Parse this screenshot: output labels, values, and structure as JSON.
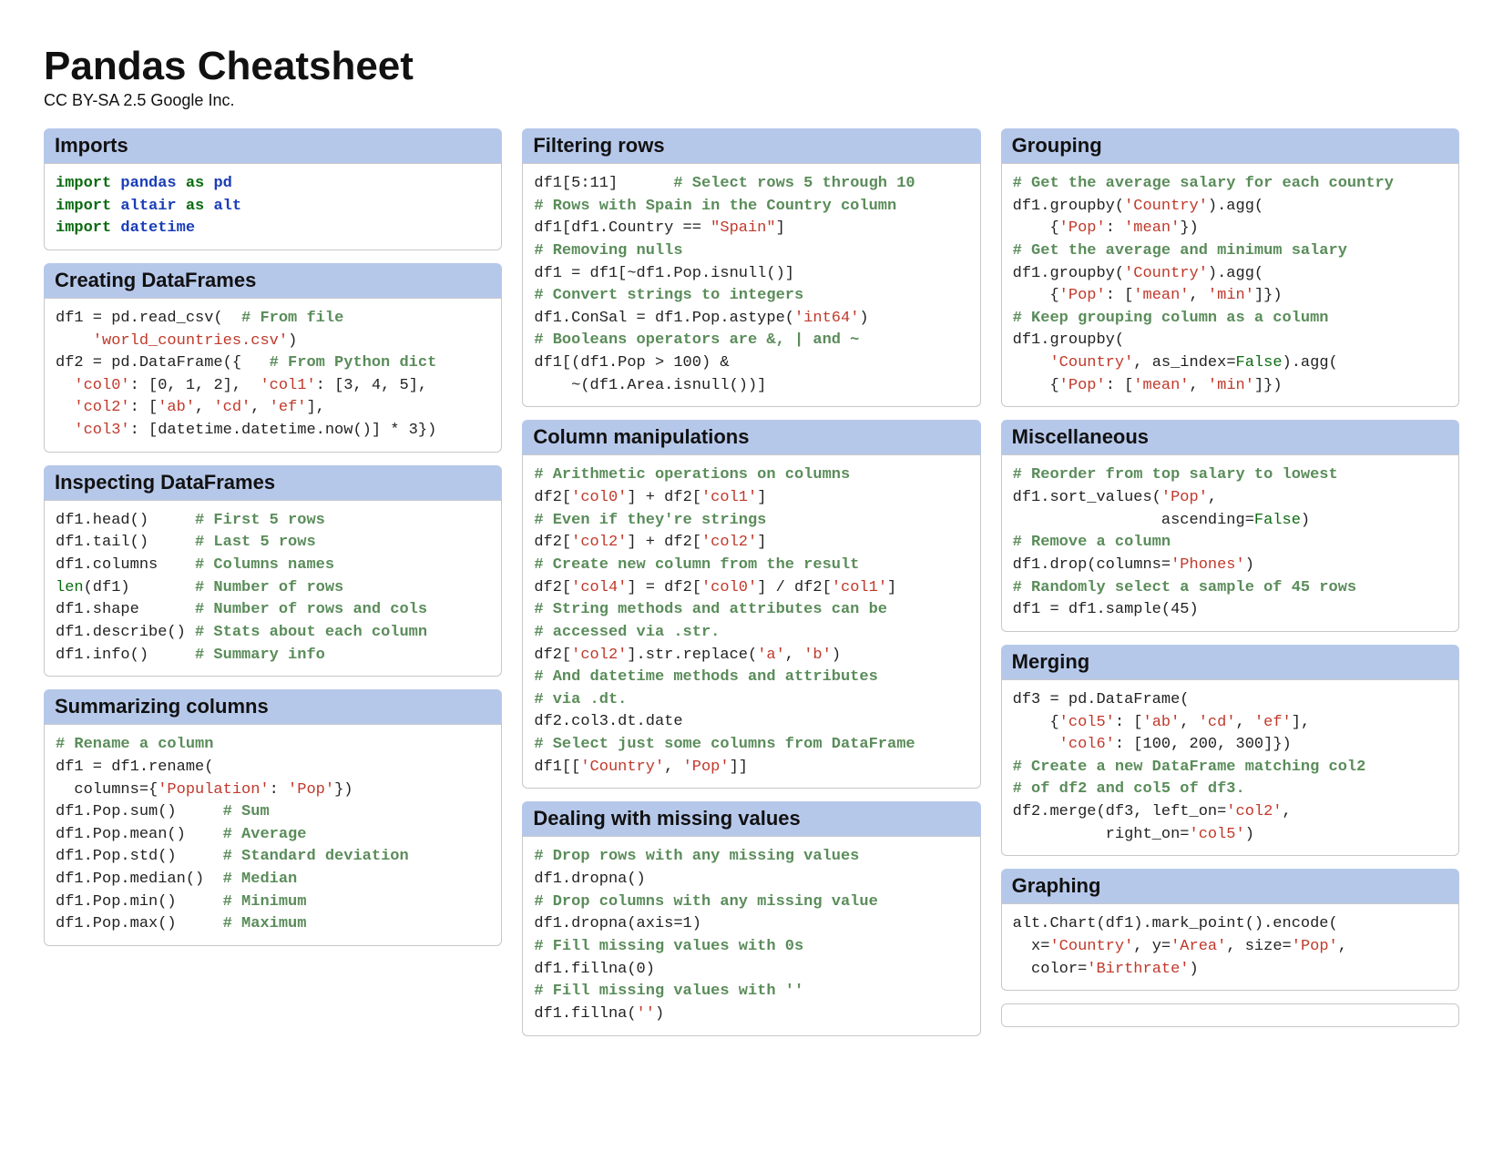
{
  "title": "Pandas Cheatsheet",
  "subtitle": "CC BY-SA 2.5 Google Inc.",
  "sections": {
    "imports": {
      "header": "Imports",
      "code": "<span class=\"kw\">import</span> <span class=\"mod\">pandas</span> <span class=\"kw\">as</span> <span class=\"mod\">pd</span>\n<span class=\"kw\">import</span> <span class=\"mod\">altair</span> <span class=\"kw\">as</span> <span class=\"mod\">alt</span>\n<span class=\"kw\">import</span> <span class=\"mod\">datetime</span>"
    },
    "creating": {
      "header": "Creating DataFrames",
      "code": "df1 = pd.read_csv(  <span class=\"cm\"># From file</span>\n    <span class=\"str\">'world_countries.csv'</span>)\ndf2 = pd.DataFrame({   <span class=\"cm\"># From Python dict</span>\n  <span class=\"str\">'col0'</span>: [0, 1, 2],  <span class=\"str\">'col1'</span>: [3, 4, 5],\n  <span class=\"str\">'col2'</span>: [<span class=\"str\">'ab'</span>, <span class=\"str\">'cd'</span>, <span class=\"str\">'ef'</span>],\n  <span class=\"str\">'col3'</span>: [datetime.datetime.now()] * 3})"
    },
    "inspecting": {
      "header": "Inspecting DataFrames",
      "code": "df1.head()     <span class=\"cm\"># First 5 rows</span>\ndf1.tail()     <span class=\"cm\"># Last 5 rows</span>\ndf1.columns    <span class=\"cm\"># Columns names</span>\n<span class=\"bi\">len</span>(df1)       <span class=\"cm\"># Number of rows</span>\ndf1.shape      <span class=\"cm\"># Number of rows and cols</span>\ndf1.describe() <span class=\"cm\"># Stats about each column</span>\ndf1.info()     <span class=\"cm\"># Summary info</span>"
    },
    "summarizing": {
      "header": "Summarizing columns",
      "code": "<span class=\"cm\"># Rename a column</span>\ndf1 = df1.rename(\n  columns={<span class=\"str\">'Population'</span>: <span class=\"str\">'Pop'</span>})\ndf1.Pop.sum()     <span class=\"cm\"># Sum</span>\ndf1.Pop.mean()    <span class=\"cm\"># Average</span>\ndf1.Pop.std()     <span class=\"cm\"># Standard deviation</span>\ndf1.Pop.median()  <span class=\"cm\"># Median</span>\ndf1.Pop.min()     <span class=\"cm\"># Minimum</span>\ndf1.Pop.max()     <span class=\"cm\"># Maximum</span>"
    },
    "filtering": {
      "header": "Filtering rows",
      "code": "df1[5:11]      <span class=\"cm\"># Select rows 5 through 10</span>\n<span class=\"cm\"># Rows with Spain in the Country column</span>\ndf1[df1.Country == <span class=\"str\">\"Spain\"</span>]\n<span class=\"cm\"># Removing nulls</span>\ndf1 = df1[~df1.Pop.isnull()]\n<span class=\"cm\"># Convert strings to integers</span>\ndf1.ConSal = df1.Pop.astype(<span class=\"str\">'int64'</span>)\n<span class=\"cm\"># Booleans operators are &, | and ~</span>\ndf1[(df1.Pop > 100) &\n    ~(df1.Area.isnull())]"
    },
    "columns": {
      "header": "Column manipulations",
      "code": "<span class=\"cm\"># Arithmetic operations on columns</span>\ndf2[<span class=\"str\">'col0'</span>] + df2[<span class=\"str\">'col1'</span>]\n<span class=\"cm\"># Even if they're strings</span>\ndf2[<span class=\"str\">'col2'</span>] + df2[<span class=\"str\">'col2'</span>]\n<span class=\"cm\"># Create new column from the result</span>\ndf2[<span class=\"str\">'col4'</span>] = df2[<span class=\"str\">'col0'</span>] / df2[<span class=\"str\">'col1'</span>]\n<span class=\"cm\"># String methods and attributes can be</span>\n<span class=\"cm\"># accessed via .str.</span>\ndf2[<span class=\"str\">'col2'</span>].str.replace(<span class=\"str\">'a'</span>, <span class=\"str\">'b'</span>)\n<span class=\"cm\"># And datetime methods and attributes</span>\n<span class=\"cm\"># via .dt.</span>\ndf2.col3.dt.date\n<span class=\"cm\"># Select just some columns from DataFrame</span>\ndf1[[<span class=\"str\">'Country'</span>, <span class=\"str\">'Pop'</span>]]"
    },
    "missing": {
      "header": "Dealing with missing values",
      "code": "<span class=\"cm\"># Drop rows with any missing values</span>\ndf1.dropna()\n<span class=\"cm\"># Drop columns with any missing value</span>\ndf1.dropna(axis=1)\n<span class=\"cm\"># Fill missing values with 0s</span>\ndf1.fillna(0)\n<span class=\"cm\"># Fill missing values with ''</span>\ndf1.fillna(<span class=\"str\">''</span>)"
    },
    "grouping": {
      "header": "Grouping",
      "code": "<span class=\"cm\"># Get the average salary for each country</span>\ndf1.groupby(<span class=\"str\">'Country'</span>).agg(\n    {<span class=\"str\">'Pop'</span>: <span class=\"str\">'mean'</span>})\n<span class=\"cm\"># Get the average and minimum salary</span>\ndf1.groupby(<span class=\"str\">'Country'</span>).agg(\n    {<span class=\"str\">'Pop'</span>: [<span class=\"str\">'mean'</span>, <span class=\"str\">'min'</span>]})\n<span class=\"cm\"># Keep grouping column as a column</span>\ndf1.groupby(\n    <span class=\"str\">'Country'</span>, as_index=<span class=\"bi\">False</span>).agg(\n    {<span class=\"str\">'Pop'</span>: [<span class=\"str\">'mean'</span>, <span class=\"str\">'min'</span>]})"
    },
    "misc": {
      "header": "Miscellaneous",
      "code": "<span class=\"cm\"># Reorder from top salary to lowest</span>\ndf1.sort_values(<span class=\"str\">'Pop'</span>,\n                ascending=<span class=\"bi\">False</span>)\n<span class=\"cm\"># Remove a column</span>\ndf1.drop(columns=<span class=\"str\">'Phones'</span>)\n<span class=\"cm\"># Randomly select a sample of 45 rows</span>\ndf1 = df1.sample(45)"
    },
    "merging": {
      "header": "Merging",
      "code": "df3 = pd.DataFrame(\n    {<span class=\"str\">'col5'</span>: [<span class=\"str\">'ab'</span>, <span class=\"str\">'cd'</span>, <span class=\"str\">'ef'</span>],\n     <span class=\"str\">'col6'</span>: [100, 200, 300]})\n<span class=\"cm\"># Create a new DataFrame matching col2</span>\n<span class=\"cm\"># of df2 and col5 of df3.</span>\ndf2.merge(df3, left_on=<span class=\"str\">'col2'</span>,\n          right_on=<span class=\"str\">'col5'</span>)"
    },
    "graphing": {
      "header": "Graphing",
      "code": "alt.Chart(df1).mark_point().encode(\n  x=<span class=\"str\">'Country'</span>, y=<span class=\"str\">'Area'</span>, size=<span class=\"str\">'Pop'</span>,\n  color=<span class=\"str\">'Birthrate'</span>)"
    }
  }
}
